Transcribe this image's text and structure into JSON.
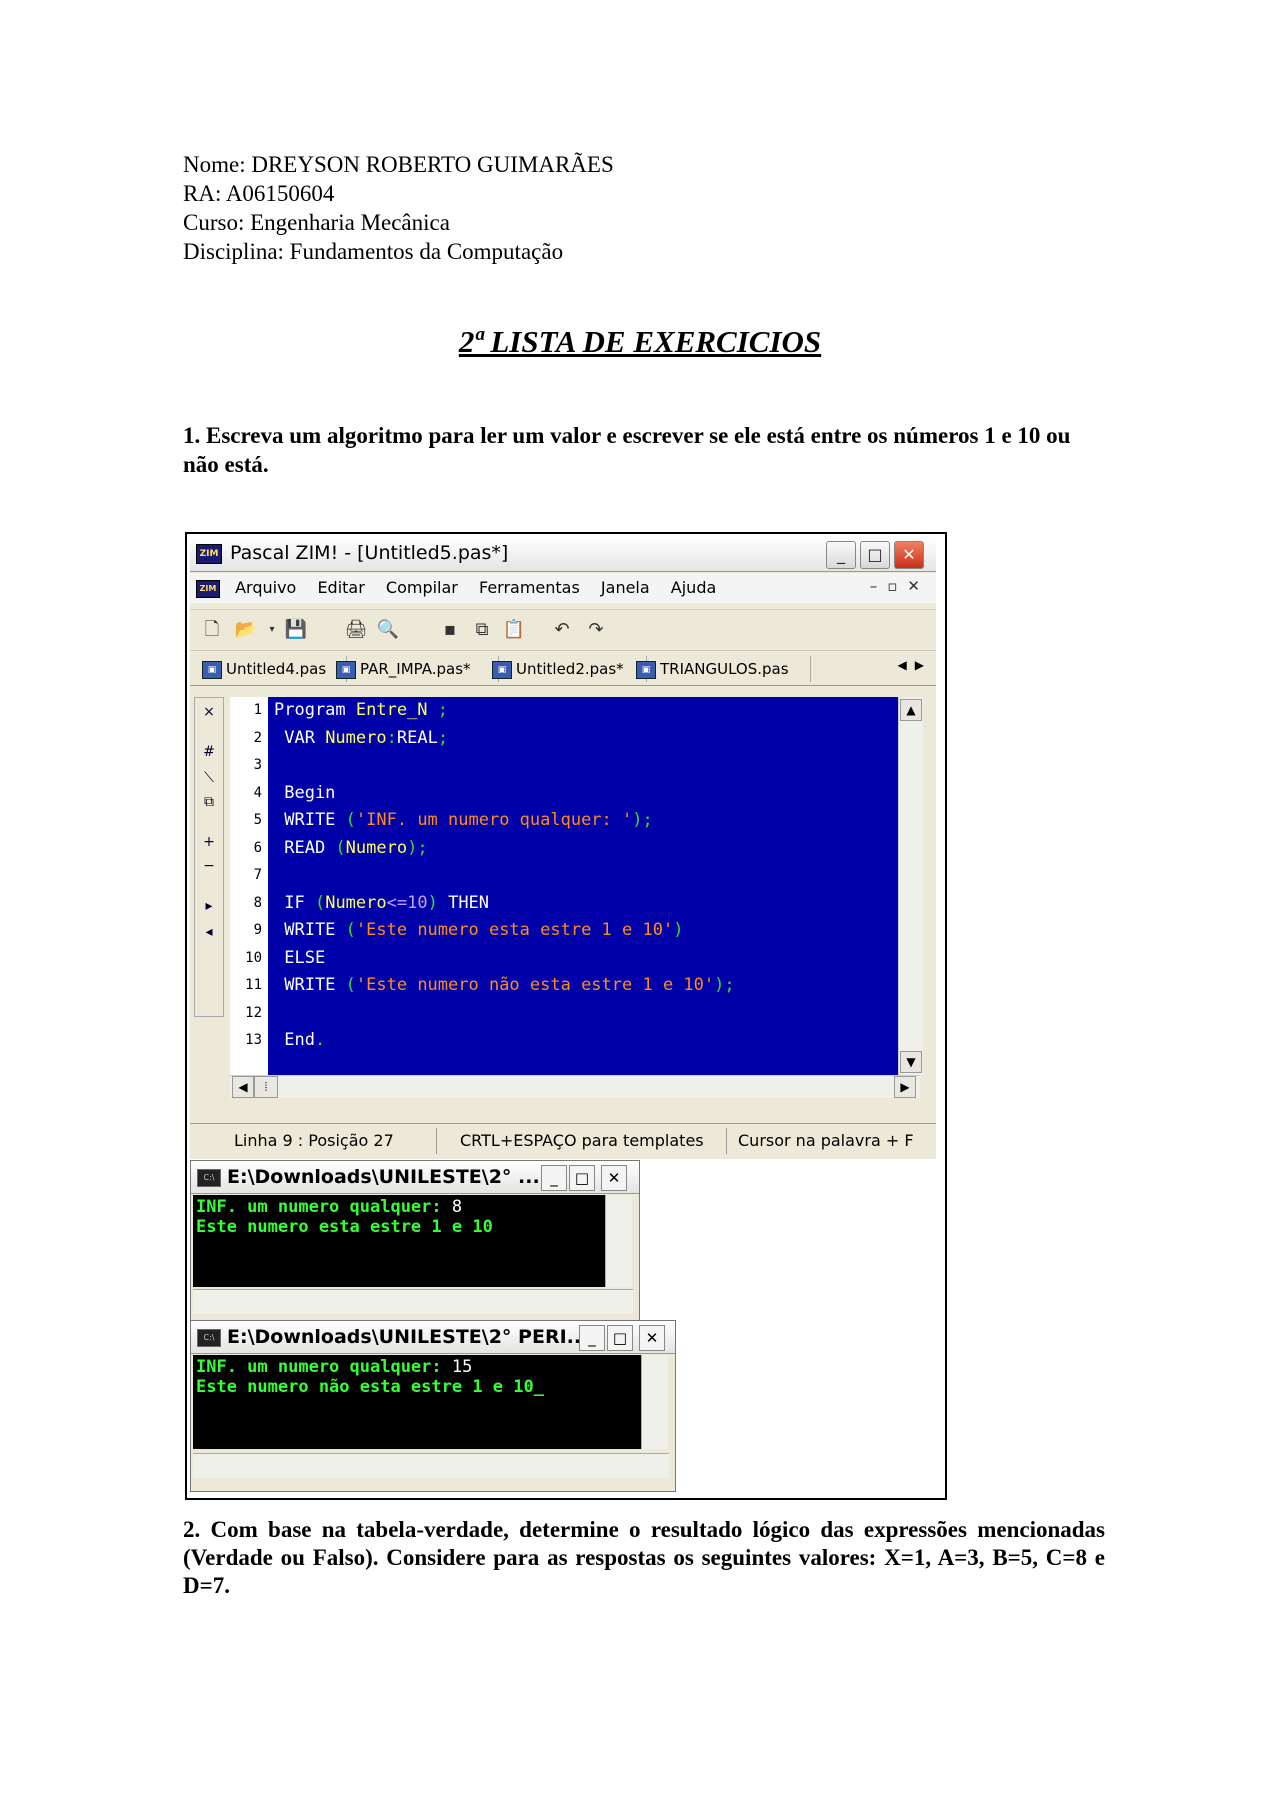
{
  "header": {
    "nome": "Nome: DREYSON ROBERTO GUIMARÃES",
    "ra": "RA: A06150604",
    "curso": "Curso: Engenharia Mecânica",
    "disciplina": "Disciplina: Fundamentos da Computação"
  },
  "title": "2ª LISTA DE EXERCICIOS",
  "question1": "1. Escreva um algoritmo para ler um valor e escrever se ele está entre os números 1 e 10 ou não está.",
  "question2": "2. Com base na tabela-verdade, determine o resultado lógico das expressões mencionadas (Verdade ou Falso). Considere para as respostas os seguintes valores: X=1, A=3, B=5, C=8 e D=7.",
  "ide": {
    "window_title": "Pascal ZIM!  - [Untitled5.pas*]",
    "logo_text": "ZIM",
    "menu": [
      "Arquivo",
      "Editar",
      "Compilar",
      "Ferramentas",
      "Janela",
      "Ajuda"
    ],
    "tabs": [
      "Untitled4.pas",
      "PAR_IMPA.pas*",
      "Untitled2.pas*",
      "TRIANGULOS.pas"
    ],
    "line_numbers": [
      "1",
      "2",
      "3",
      "4",
      "5",
      "6",
      "7",
      "8",
      "9",
      "10",
      "11",
      "12",
      "13"
    ],
    "code": {
      "l1_kw": "Program ",
      "l1_id": "Entre_N",
      "l1_p": " ;",
      "l2_kw": " VAR ",
      "l2_id": "Numero",
      "l2_p": ":",
      "l2_kw2": "REAL",
      "l2_p2": ";",
      "l4_kw": " Begin",
      "l5_kw": " WRITE ",
      "l5_p": "(",
      "l5_s": "'INF. um numero qualquer: '",
      "l5_p2": ");",
      "l6_kw": " READ ",
      "l6_p": "(",
      "l6_id": "Numero",
      "l6_p2": ");",
      "l8_kw": " IF ",
      "l8_p": "(",
      "l8_id": "Numero",
      "l8_op": "<=",
      "l8_n": "10",
      "l8_p2": ")",
      "l8_kw2": " THEN",
      "l9_kw": " WRITE ",
      "l9_p": "(",
      "l9_s": "'Este numero esta estre 1 e 10'",
      "l9_p2": ")",
      "l10_kw": " ELSE",
      "l11_kw": " WRITE ",
      "l11_p": "(",
      "l11_s": "'Este numero não esta estre 1 e 10'",
      "l11_p2": ");",
      "l13_kw": " End",
      "l13_p": "."
    },
    "status": {
      "position": "Linha 9 : Posição 27",
      "templates": "CRTL+ESPAÇO para templates",
      "cursor": "Cursor na palavra + F"
    }
  },
  "console1": {
    "title": "E:\\Downloads\\UNILESTE\\2° ...",
    "line1": "INF. um numero qualquer: ",
    "input": "8",
    "line2": "Este numero esta estre 1 e 10"
  },
  "console2": {
    "title": "E:\\Downloads\\UNILESTE\\2° PERI...",
    "line1": "INF. um numero qualquer: ",
    "input": "15",
    "line2": "Este numero não esta estre 1 e 10_"
  }
}
